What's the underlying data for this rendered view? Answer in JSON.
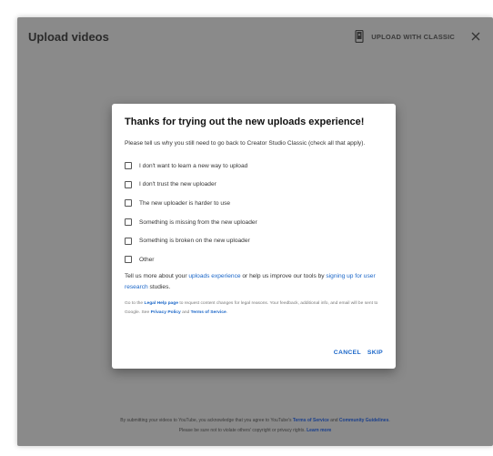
{
  "window": {
    "title": "Upload videos",
    "upload_classic_label": "UPLOAD WITH CLASSIC"
  },
  "dialog": {
    "title": "Thanks for trying out the new uploads experience!",
    "description": "Please tell us why you still need to go back to Creator Studio Classic (check all that apply).",
    "options": [
      {
        "label": "I don't want to learn a new way to upload",
        "checked": false
      },
      {
        "label": "I don't trust the new uploader",
        "checked": false
      },
      {
        "label": "The new uploader is harder to use",
        "checked": false
      },
      {
        "label": "Something is missing from the new uploader",
        "checked": false
      },
      {
        "label": "Something is broken on the new uploader",
        "checked": false
      },
      {
        "label": "Other",
        "checked": false
      }
    ],
    "more": {
      "prefix": "Tell us more about your ",
      "uploads_link": "uploads experience",
      "middle": " or help us improve our tools by ",
      "research_link": "signing up for user research",
      "suffix": " studies."
    },
    "legal": {
      "prefix": "Go to the ",
      "legal_link": "Legal Help page",
      "middle": " to request content changes for legal reasons. Your feedback, additional info, and email will be sent to Google. See ",
      "privacy_link": "Privacy Policy",
      "and": " and ",
      "terms_link": "Terms of Service",
      "suffix": "."
    },
    "cancel_label": "CANCEL",
    "skip_label": "SKIP"
  },
  "footer": {
    "prefix": "By submitting your videos to YouTube, you acknowledge that you agree to YouTube's ",
    "terms_link": "Terms of Service",
    "and": " and ",
    "guidelines_link": "Community Guidelines",
    "suffix": ".",
    "line2": "Please be sure not to violate others' copyright or privacy rights. ",
    "learn_more": "Learn more"
  },
  "colors": {
    "overlay": "#8a8a8a",
    "link": "#1a66c8",
    "dialog_bg": "#ffffff"
  },
  "icons": {
    "classic": "phone-upload-icon",
    "close": "close-icon"
  }
}
